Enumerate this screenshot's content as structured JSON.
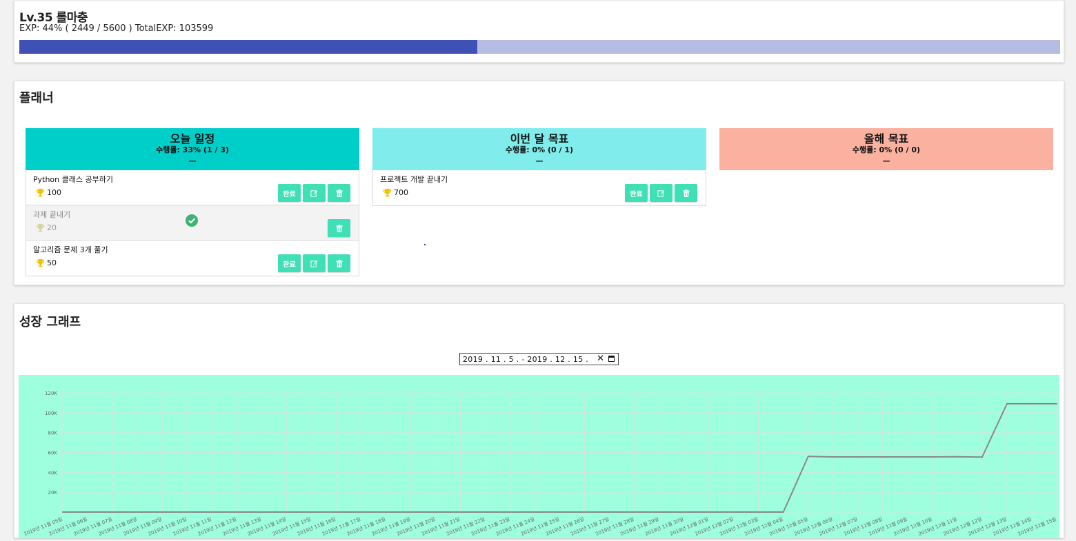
{
  "level": {
    "title": "Lv.35 롤마충",
    "exp_text": "EXP: 44% ( 2449 / 5600 ) TotalEXP: 103599",
    "exp_fraction": 0.44,
    "colors": {
      "fill": "#3f51b5",
      "track": "#b6bce4"
    }
  },
  "planner": {
    "title": "플래너",
    "today": {
      "title": "오늘 일정",
      "rate": "수행률: 33% (1 / 3)",
      "dash": "—",
      "color": "#00cec9",
      "items": [
        {
          "name": "Python 클래스 공부하기",
          "reward": "100",
          "done": false
        },
        {
          "name": "과제 끝내기",
          "reward": "20",
          "done": true
        },
        {
          "name": "알고리즘 문제 3개 풀기",
          "reward": "50",
          "done": false
        }
      ]
    },
    "month": {
      "title": "이번 달 목표",
      "rate": "수행률: 0% (0 / 1)",
      "dash": "—",
      "color": "#81ecec",
      "items": [
        {
          "name": "프로젝트 개발 끝내기",
          "reward": "700",
          "done": false
        }
      ]
    },
    "year": {
      "title": "올해 목표",
      "rate": "수행률: 0% (0 / 0)",
      "dash": "—",
      "color": "#fab1a0",
      "items": []
    },
    "buttons": {
      "complete": "완료",
      "edit_icon": "edit-icon",
      "delete_icon": "trash-icon"
    },
    "icons": {
      "reward": "trophy-icon",
      "done": "check-circle-icon"
    }
  },
  "graph": {
    "title": "성장 그래프",
    "date_range": "2019 . 11 . 5 . - 2019 . 12 . 15 .",
    "clear_icon": "close-icon",
    "calendar_icon": "calendar-icon",
    "chart_data": {
      "type": "line",
      "title": "",
      "xlabel": "",
      "ylabel": "",
      "grid": true,
      "background": "#9effde",
      "line_color": "#888888",
      "ylim": [
        0,
        120000
      ],
      "yticks": [
        "20K",
        "40K",
        "60K",
        "80K",
        "100K",
        "120K"
      ],
      "ytick_values": [
        20000,
        40000,
        60000,
        80000,
        100000,
        120000
      ],
      "categories": [
        "2019년 11월 05일",
        "2019년 11월 06일",
        "2019년 11월 07일",
        "2019년 11월 08일",
        "2019년 11월 09일",
        "2019년 11월 10일",
        "2019년 11월 11일",
        "2019년 11월 12일",
        "2019년 11월 13일",
        "2019년 11월 14일",
        "2019년 11월 15일",
        "2019년 11월 16일",
        "2019년 11월 17일",
        "2019년 11월 18일",
        "2019년 11월 19일",
        "2019년 11월 20일",
        "2019년 11월 21일",
        "2019년 11월 22일",
        "2019년 11월 23일",
        "2019년 11월 24일",
        "2019년 11월 25일",
        "2019년 11월 26일",
        "2019년 11월 27일",
        "2019년 11월 28일",
        "2019년 11월 29일",
        "2019년 11월 30일",
        "2019년 12월 01일",
        "2019년 12월 02일",
        "2019년 12월 03일",
        "2019년 12월 04일",
        "2019년 12월 05일",
        "2019년 12월 06일",
        "2019년 12월 07일",
        "2019년 12월 08일",
        "2019년 12월 09일",
        "2019년 12월 10일",
        "2019년 12월 11일",
        "2019년 12월 12일",
        "2019년 12월 13일",
        "2019년 12월 14일",
        "2019년 12월 15일"
      ],
      "series": [
        {
          "values": [
            0,
            0,
            0,
            0,
            0,
            0,
            0,
            0,
            0,
            0,
            0,
            0,
            0,
            0,
            0,
            0,
            0,
            0,
            0,
            0,
            0,
            0,
            0,
            0,
            0,
            0,
            0,
            0,
            0,
            0,
            56000,
            55500,
            55500,
            55500,
            55500,
            55500,
            55700,
            55300,
            109000,
            109000,
            109000
          ]
        }
      ]
    }
  }
}
